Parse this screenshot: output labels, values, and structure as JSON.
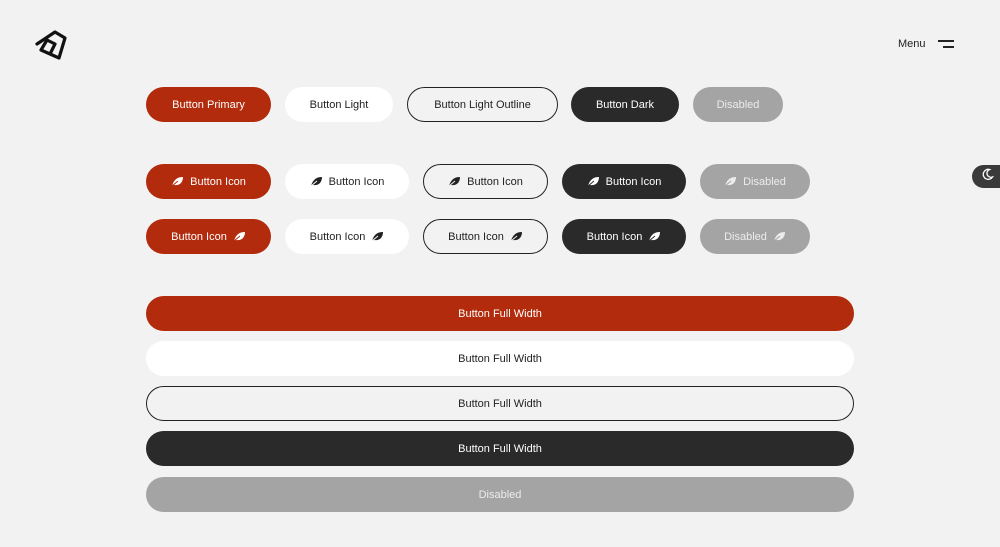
{
  "header": {
    "menu_label": "Menu"
  },
  "icons": {
    "logo": "brand-logo",
    "menu": "hamburger-icon",
    "theme": "moon-icon",
    "button": "leaf-icon"
  },
  "colors": {
    "primary": "#b22b0c",
    "light": "#ffffff",
    "dark": "#2a2a2a",
    "disabled": "#a4a4a4",
    "background": "#f2f2f2"
  },
  "row1": {
    "primary": "Button Primary",
    "light": "Button Light",
    "outline": "Button Light Outline",
    "dark": "Button Dark",
    "disabled": "Disabled"
  },
  "row2": {
    "primary": "Button Icon",
    "light": "Button Icon",
    "outline": "Button Icon",
    "dark": "Button Icon",
    "disabled": "Disabled"
  },
  "row3": {
    "primary": "Button Icon",
    "light": "Button Icon",
    "outline": "Button Icon",
    "dark": "Button Icon",
    "disabled": "Disabled"
  },
  "full_width": {
    "primary": "Button Full Width",
    "light": "Button Full Width",
    "outline": "Button Full Width",
    "dark": "Button Full Width",
    "disabled": "Disabled"
  }
}
